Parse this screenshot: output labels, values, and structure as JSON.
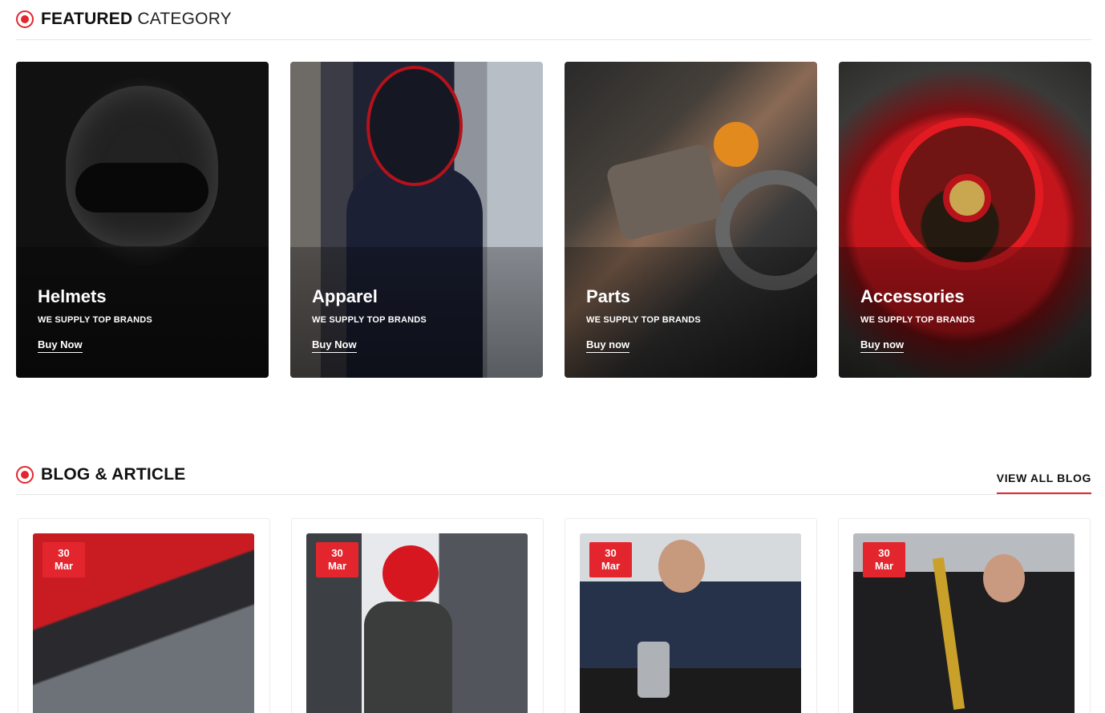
{
  "featured": {
    "title_bold": "FEATURED",
    "title_light": "CATEGORY",
    "icon": "record-dot-icon",
    "categories": [
      {
        "name": "Helmets",
        "subtitle": "WE SUPPLY TOP BRANDS",
        "cta": "Buy Now"
      },
      {
        "name": "Apparel",
        "subtitle": "WE SUPPLY TOP BRANDS",
        "cta": "Buy Now"
      },
      {
        "name": "Parts",
        "subtitle": "WE SUPPLY TOP BRANDS",
        "cta": "Buy now"
      },
      {
        "name": "Accessories",
        "subtitle": "WE SUPPLY TOP BRANDS",
        "cta": "Buy now"
      }
    ]
  },
  "blog": {
    "title": "BLOG & ARTICLE",
    "icon": "record-dot-icon",
    "view_all": "VIEW ALL BLOG",
    "posts": [
      {
        "day": "30",
        "month": "Mar"
      },
      {
        "day": "30",
        "month": "Mar"
      },
      {
        "day": "30",
        "month": "Mar"
      },
      {
        "day": "30",
        "month": "Mar"
      }
    ]
  },
  "colors": {
    "accent": "#e3262e",
    "text": "#111111",
    "divider": "#e5e5e5"
  }
}
